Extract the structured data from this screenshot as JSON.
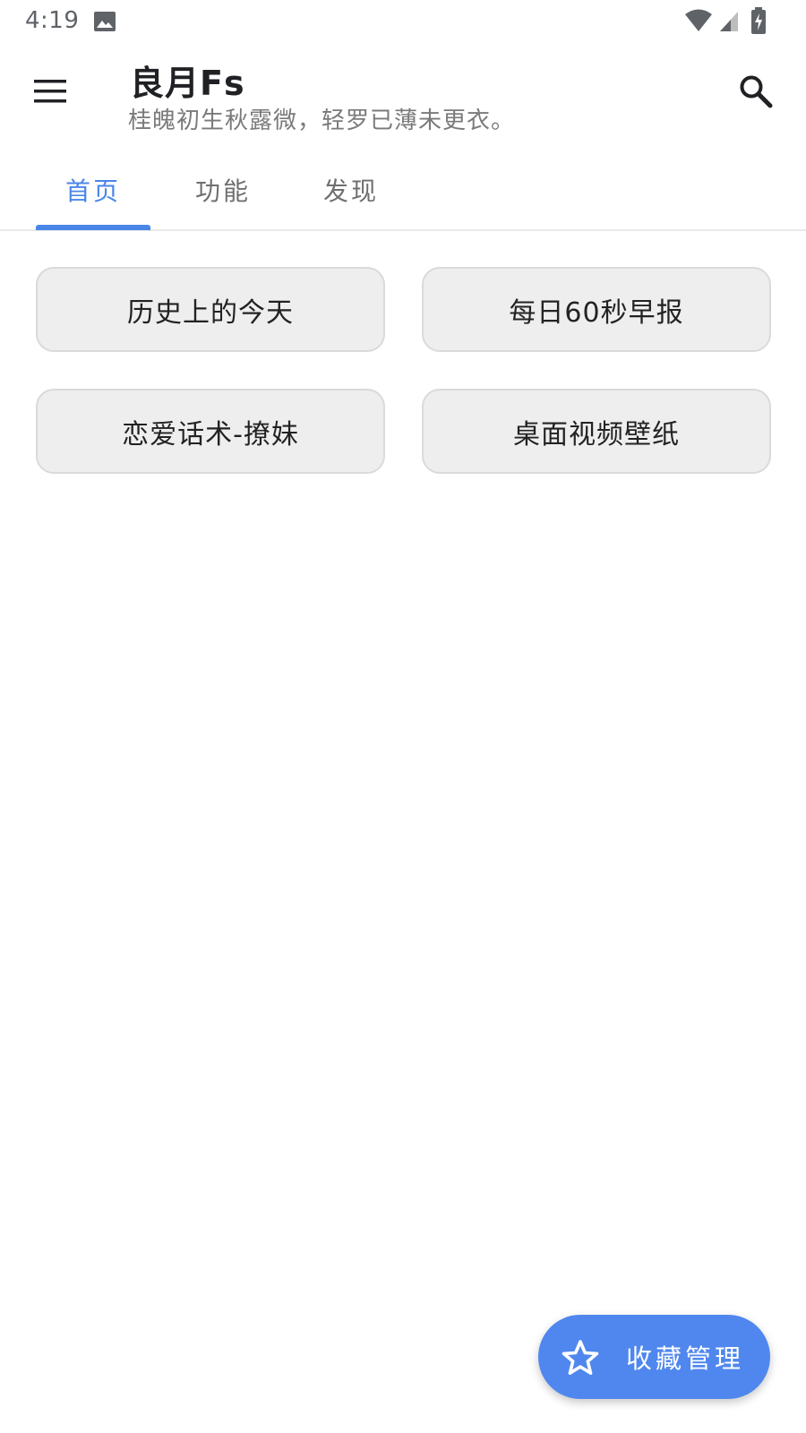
{
  "status_bar": {
    "time": "4:19",
    "icons": [
      "gallery-icon",
      "wifi-icon",
      "signal-icon",
      "battery-charging-icon"
    ]
  },
  "app_bar": {
    "menu_icon": "menu-icon",
    "title": "良月Fs",
    "subtitle": "桂魄初生秋露微，轻罗已薄未更衣。",
    "search_icon": "search-icon"
  },
  "tabs": [
    {
      "label": "首页",
      "active": true
    },
    {
      "label": "功能",
      "active": false
    },
    {
      "label": "发现",
      "active": false
    }
  ],
  "main": {
    "buttons": [
      {
        "label": "历史上的今天"
      },
      {
        "label": "每日60秒早报"
      },
      {
        "label": "恋爱话术-撩妹"
      },
      {
        "label": "桌面视频壁纸"
      }
    ]
  },
  "fab": {
    "icon": "star-outline-icon",
    "label": "收藏管理"
  },
  "colors": {
    "accent": "#4a86e8",
    "fab_background": "#4f87ee",
    "button_background": "#eeeeee",
    "subtitle_text": "#7a7a7a"
  }
}
